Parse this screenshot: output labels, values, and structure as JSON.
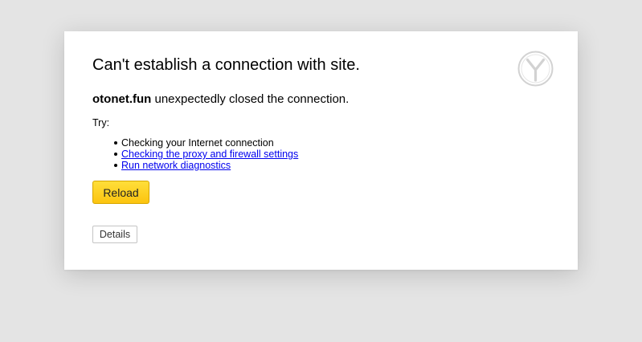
{
  "error": {
    "title": "Can't establish a connection with site.",
    "host": "otonet.fun",
    "message": " unexpectedly closed the connection.",
    "try_label": "Try:",
    "suggestions": [
      {
        "text": "Checking your Internet connection",
        "is_link": false
      },
      {
        "text": "Checking the proxy and firewall settings",
        "is_link": true
      },
      {
        "text": "Run network diagnostics",
        "is_link": true
      }
    ]
  },
  "buttons": {
    "reload_label": "Reload",
    "details_label": "Details"
  },
  "logo": {
    "icon": "yandex-browser-logo-icon"
  },
  "colors": {
    "page_background": "#e4e4e4",
    "card_background": "#ffffff",
    "link": "#0000ee",
    "reload_button": "#fdd12a"
  }
}
